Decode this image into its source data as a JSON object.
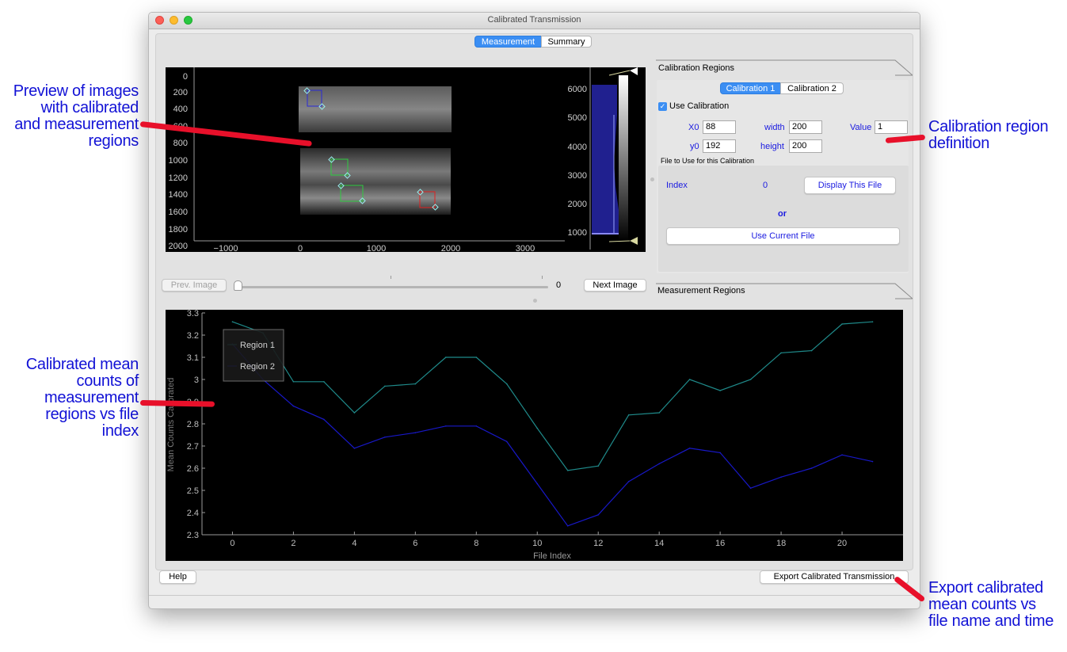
{
  "annotations": {
    "preview": [
      "Preview of images",
      "with calibrated",
      "and measurement",
      "regions"
    ],
    "calib_def": [
      "Calibration region",
      "definition"
    ],
    "mean_counts": [
      "Calibrated mean",
      "counts of",
      "measurement",
      "regions vs file",
      "index"
    ],
    "export": [
      "Export calibrated",
      "mean counts vs",
      "file name and time"
    ]
  },
  "window": {
    "title": "Calibrated Transmission"
  },
  "main_tabs": [
    "Measurement",
    "Summary"
  ],
  "preview": {
    "y_ticks": [
      "0",
      "200",
      "400",
      "600",
      "800",
      "1000",
      "1200",
      "1400",
      "1600",
      "1800",
      "2000"
    ],
    "x_ticks": [
      "−1000",
      "0",
      "1000",
      "2000",
      "3000"
    ],
    "hist_ticks": [
      "6000",
      "5000",
      "4000",
      "3000",
      "2000",
      "1000"
    ]
  },
  "slider": {
    "prev_label": "Prev. Image",
    "next_label": "Next Image",
    "value": "0"
  },
  "calibration": {
    "panel_title": "Calibration Regions",
    "tabs": [
      "Calibration 1",
      "Calibration 2"
    ],
    "use_label": "Use Calibration",
    "use_checked": true,
    "x0_label": "X0",
    "x0_value": "88",
    "width_label": "width",
    "width_value": "200",
    "value_label": "Value",
    "value_value": "1",
    "y0_label": "y0",
    "y0_value": "192",
    "height_label": "height",
    "height_value": "200",
    "file_label": "File to Use for this Calibration",
    "index_label": "Index",
    "index_value": "0",
    "display_label": "Display This File",
    "or_label": "or",
    "use_current_label": "Use Current File"
  },
  "measurement": {
    "panel_title": "Measurement Regions"
  },
  "buttons": {
    "help": "Help",
    "export": "Export Calibrated Transmission"
  },
  "chart_data": {
    "type": "line",
    "xlabel": "File Index",
    "ylabel": "Mean Counts Calibrated",
    "xlim": [
      -1,
      22
    ],
    "ylim": [
      2.3,
      3.3
    ],
    "x_ticks": [
      0,
      2,
      4,
      6,
      8,
      10,
      12,
      14,
      16,
      18,
      20
    ],
    "y_ticks": [
      2.3,
      2.4,
      2.5,
      2.6,
      2.7,
      2.8,
      2.9,
      3.0,
      3.1,
      3.2,
      3.3
    ],
    "y_tick_labels": [
      "2.3",
      "2.4",
      "2.5",
      "2.6",
      "2.7",
      "2.8",
      "2.9",
      "3",
      "3.1",
      "3.2",
      "3.3"
    ],
    "x": [
      0,
      1,
      2,
      3,
      4,
      5,
      6,
      7,
      8,
      9,
      10,
      11,
      12,
      13,
      14,
      15,
      16,
      17,
      18,
      19,
      20,
      21
    ],
    "series": [
      {
        "name": "Region 1",
        "color": "#1f8a8a",
        "values": [
          3.26,
          3.21,
          2.99,
          2.99,
          2.85,
          2.97,
          2.98,
          3.1,
          3.1,
          2.98,
          2.78,
          2.59,
          2.61,
          2.84,
          2.85,
          3.0,
          2.95,
          3.0,
          3.12,
          3.13,
          3.25,
          3.26
        ]
      },
      {
        "name": "Region 2",
        "color": "#1818c8",
        "values": [
          3.16,
          3.0,
          2.88,
          2.82,
          2.69,
          2.74,
          2.76,
          2.79,
          2.79,
          2.72,
          2.53,
          2.34,
          2.39,
          2.54,
          2.62,
          2.69,
          2.67,
          2.51,
          2.56,
          2.6,
          2.66,
          2.63
        ]
      }
    ],
    "legend": "top-left",
    "background": "#000000",
    "axis_color": "#9a9a9a"
  }
}
